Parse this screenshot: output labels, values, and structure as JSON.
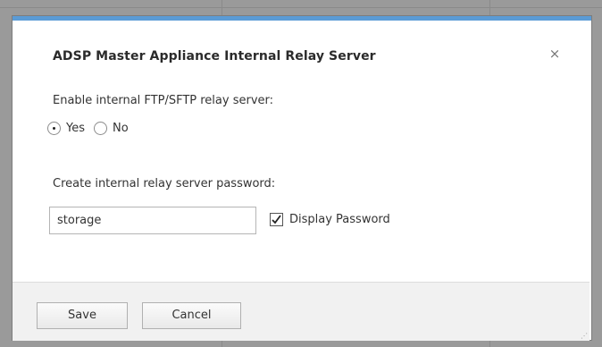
{
  "dialog": {
    "title": "ADSP Master Appliance Internal Relay Server",
    "close_glyph": "×",
    "enable_label": "Enable internal FTP/SFTP relay server:",
    "radio_options": [
      {
        "label": "Yes",
        "checked": true
      },
      {
        "label": "No",
        "checked": false
      }
    ],
    "password_label": "Create internal relay server password:",
    "password_value": "storage",
    "display_password_label": "Display Password",
    "display_password_checked": true,
    "save_label": "Save",
    "cancel_label": "Cancel"
  },
  "colors": {
    "accent_top_border": "#5b9bd5",
    "backdrop": "#9a9a9a",
    "footer": "#f1f1f1"
  },
  "icons": {
    "close": "close-icon",
    "check": "check-icon",
    "resize": "resize-grip-icon"
  }
}
